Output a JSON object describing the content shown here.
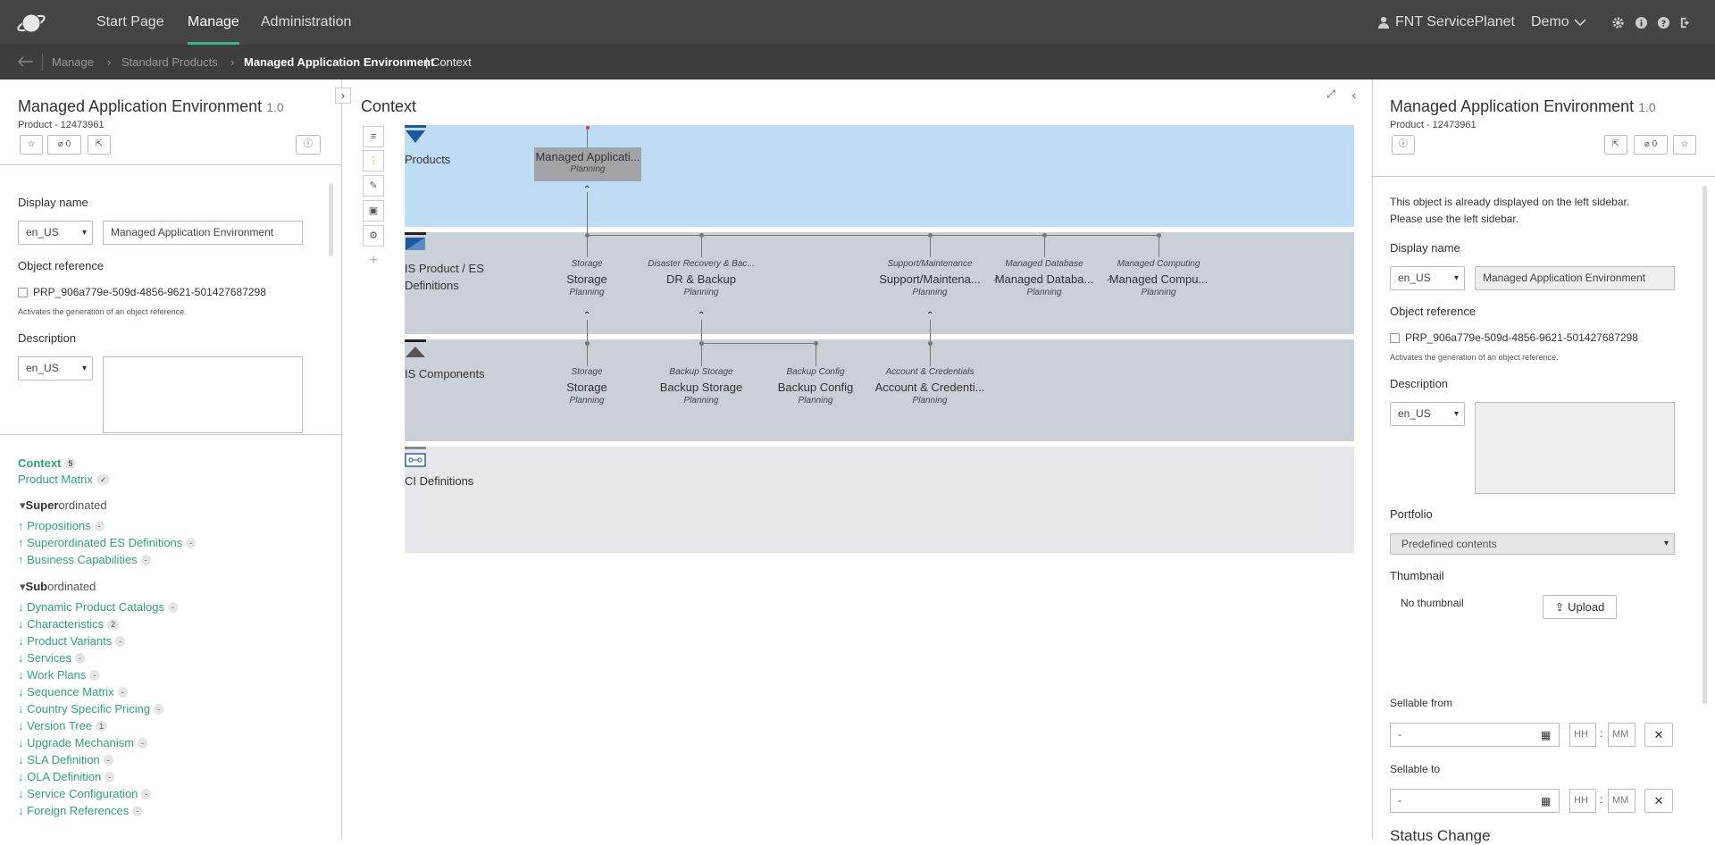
{
  "nav": {
    "start": "Start Page",
    "manage": "Manage",
    "admin": "Administration",
    "user": "FNT ServicePlanet",
    "demo": "Demo"
  },
  "breadcrumb": {
    "manage": "Manage",
    "products": "Standard Products",
    "current": "Managed Application Environment",
    "context": "| Context"
  },
  "left": {
    "title": "Managed Application Environment",
    "version": "1.0",
    "subtitle": "Product - 12473961",
    "attach_count": "0",
    "display_name_label": "Display name",
    "lang": "en_US",
    "display_name": "Managed Application Environment",
    "objref_label": "Object reference",
    "objref": "PRP_906a779e-509d-4856-9621-501427687298",
    "objref_hint": "Activates the generation of an object reference.",
    "desc_label": "Description",
    "desc_lang": "en_US",
    "context": "Context",
    "context_count": "5",
    "matrix": "Product Matrix",
    "super_b": "Super",
    "super_r": "ordinated",
    "super_items": [
      {
        "label": "↑ Propositions",
        "count": "-"
      },
      {
        "label": "↑ Superordinated ES Definitions",
        "count": "-"
      },
      {
        "label": "↑ Business Capabilities",
        "count": "-"
      }
    ],
    "sub_b": "Sub",
    "sub_r": "ordinated",
    "sub_items": [
      {
        "label": "↓ Dynamic Product Catalogs",
        "count": "-"
      },
      {
        "label": "↓ Characteristics",
        "count": "2"
      },
      {
        "label": "↓ Product Variants",
        "count": "-"
      },
      {
        "label": "↓ Services",
        "count": "-"
      },
      {
        "label": "↓ Work Plans",
        "count": "-"
      },
      {
        "label": "↓ Sequence Matrix",
        "count": "-"
      },
      {
        "label": "↓ Country Specific Pricing",
        "count": "-"
      },
      {
        "label": "↓ Version Tree",
        "count": "1"
      },
      {
        "label": "↓ Upgrade Mechanism",
        "count": "-"
      },
      {
        "label": "↓ SLA Definition",
        "count": "-"
      },
      {
        "label": "↓ OLA Definition",
        "count": "-"
      },
      {
        "label": "↓ Service Configuration",
        "count": "-"
      },
      {
        "label": "↓ Foreign References",
        "count": "-"
      }
    ]
  },
  "center": {
    "title": "Context",
    "lanes": [
      "Products",
      "IS Product / ES Definitions",
      "IS Components",
      "CI Definitions"
    ],
    "product_node": {
      "name": "Managed Applicati...",
      "status": "Planning"
    },
    "es_nodes": [
      {
        "cat": "Storage",
        "name": "Storage",
        "status": "Planning"
      },
      {
        "cat": "Disaster Recovery & Bac...",
        "name": "DR & Backup",
        "status": "Planning"
      },
      {
        "cat": "Support/Maintenance",
        "name": "Support/Maintena...",
        "status": "Planning"
      },
      {
        "cat": "Managed Database",
        "name": "Managed Databa...",
        "status": "Planning"
      },
      {
        "cat": "Managed Computing",
        "name": "Managed Compu...",
        "status": "Planning"
      }
    ],
    "comp_nodes": [
      {
        "cat": "Storage",
        "name": "Storage",
        "status": "Planning"
      },
      {
        "cat": "Backup Storage",
        "name": "Backup Storage",
        "status": "Planning"
      },
      {
        "cat": "Backup Config",
        "name": "Backup Config",
        "status": "Planning"
      },
      {
        "cat": "Account & Credentials",
        "name": "Account & Credenti...",
        "status": "Planning"
      }
    ]
  },
  "right": {
    "title": "Managed Application Environment",
    "version": "1.0",
    "subtitle": "Product - 12473961",
    "attach_count": "0",
    "notice1": "This object is already displayed on the left sidebar.",
    "notice2": "Please use the left sidebar.",
    "display_name_label": "Display name",
    "lang": "en_US",
    "display_name": "Managed Application Environment",
    "objref_label": "Object reference",
    "objref": "PRP_906a779e-509d-4856-9621-501427687298",
    "objref_hint": "Activates the generation of an object reference.",
    "desc_label": "Description",
    "desc_lang": "en_US",
    "portfolio_label": "Portfolio",
    "portfolio": "Predefined contents",
    "thumb_label": "Thumbnail",
    "no_thumb": "No thumbnail",
    "upload": "Upload",
    "sellable_from": "Sellable from",
    "sellable_to": "Sellable to",
    "date_ph": "-",
    "hh": "HH",
    "mm": "MM",
    "status_change": "Status Change"
  }
}
